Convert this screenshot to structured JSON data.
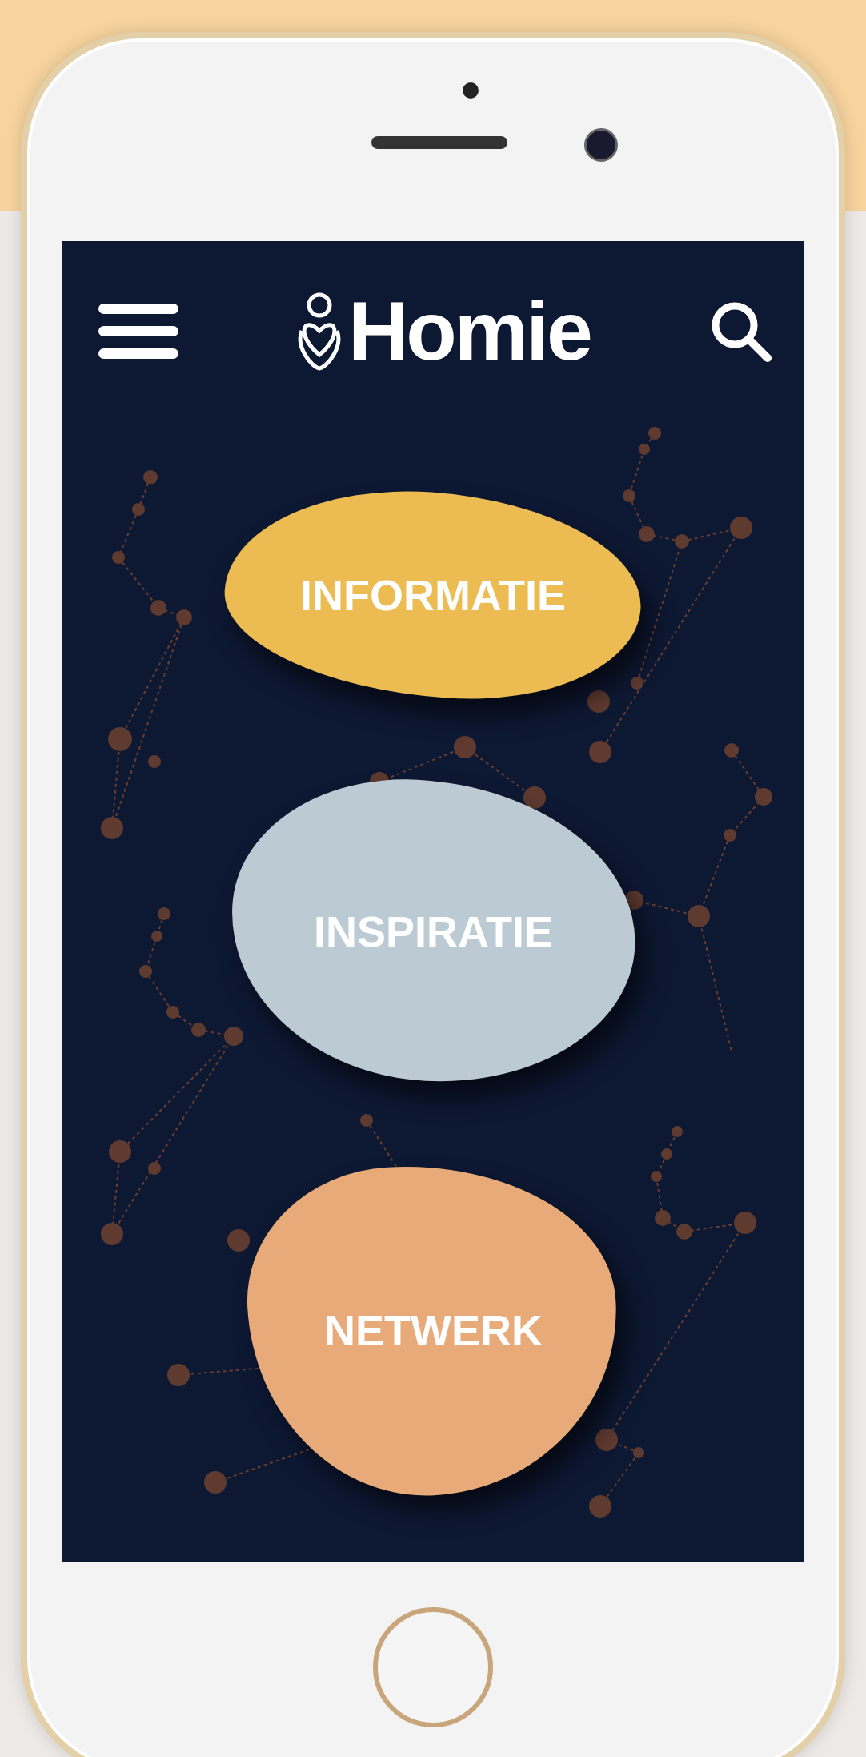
{
  "header": {
    "logo_text": "Homie"
  },
  "buttons": [
    {
      "label": "INFORMATIE",
      "color": "#ecbb51",
      "kind": "wide"
    },
    {
      "label": "INSPIRATIE",
      "color": "#bccbd3",
      "kind": "round"
    },
    {
      "label": "NETWERK",
      "color": "#e9aa79",
      "kind": "tall"
    }
  ]
}
